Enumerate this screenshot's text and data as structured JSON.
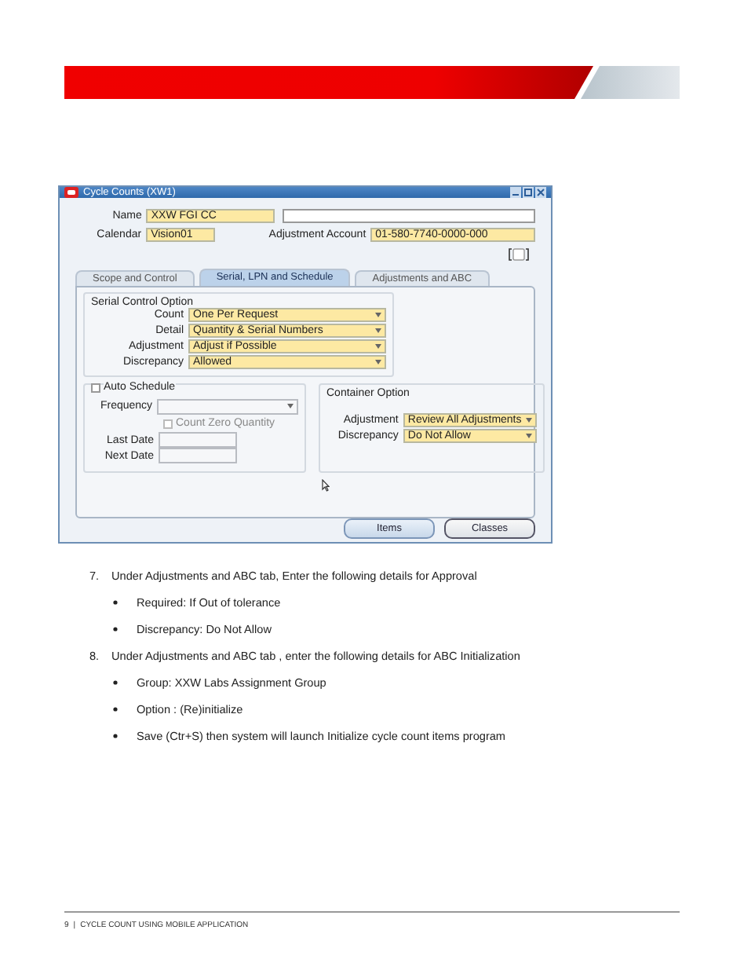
{
  "form_window": {
    "title": "Cycle Counts (XW1)",
    "name": {
      "label": "Name",
      "value": "XXW FGI CC"
    },
    "calendar": {
      "label": "Calendar",
      "value": "Vision01"
    },
    "adjustment_account": {
      "label": "Adjustment Account",
      "value": "01-580-7740-0000-000"
    },
    "tabs": [
      {
        "label": "Scope and Control",
        "selected": false
      },
      {
        "label": "Serial, LPN and Schedule",
        "selected": true
      },
      {
        "label": "Adjustments and ABC",
        "selected": false
      }
    ],
    "serial_control_option": {
      "title": "Serial Control Option",
      "fields": [
        {
          "label": "Count",
          "value": "One Per Request"
        },
        {
          "label": "Detail",
          "value": "Quantity & Serial Numbers"
        },
        {
          "label": "Adjustment",
          "value": "Adjust if Possible"
        },
        {
          "label": "Discrepancy",
          "value": "Allowed"
        }
      ]
    },
    "auto_schedule": {
      "label": "Auto Schedule",
      "checked": false,
      "frequency_label": "Frequency",
      "count_zero_quantity": {
        "label": "Count Zero Quantity",
        "checked": false
      },
      "last_date_label": "Last Date",
      "next_date_label": "Next Date"
    },
    "container_option": {
      "title": "Container Option",
      "fields": [
        {
          "label": "Adjustment",
          "value": "Review All Adjustments"
        },
        {
          "label": "Discrepancy",
          "value": "Do Not Allow"
        }
      ]
    },
    "buttons": [
      "Items",
      "Classes"
    ]
  },
  "instructions": [
    {
      "number": "7.",
      "text": "Under Adjustments and ABC tab, Enter the following details for Approval",
      "bullets": [
        "Required: If Out of tolerance",
        "Discrepancy: Do Not Allow"
      ]
    },
    {
      "number": "8.",
      "text": "Under Adjustments and ABC tab , enter the following details for ABC Initialization",
      "bullets": [
        "Group: XXW Labs Assignment Group",
        "Option : (Re)initialize",
        "Save (Ctr+S) then system will launch Initialize cycle count items program"
      ]
    }
  ],
  "footer": {
    "page": "9",
    "separator": "|",
    "title": "CYCLE COUNT USING MOBILE APPLICATION"
  }
}
